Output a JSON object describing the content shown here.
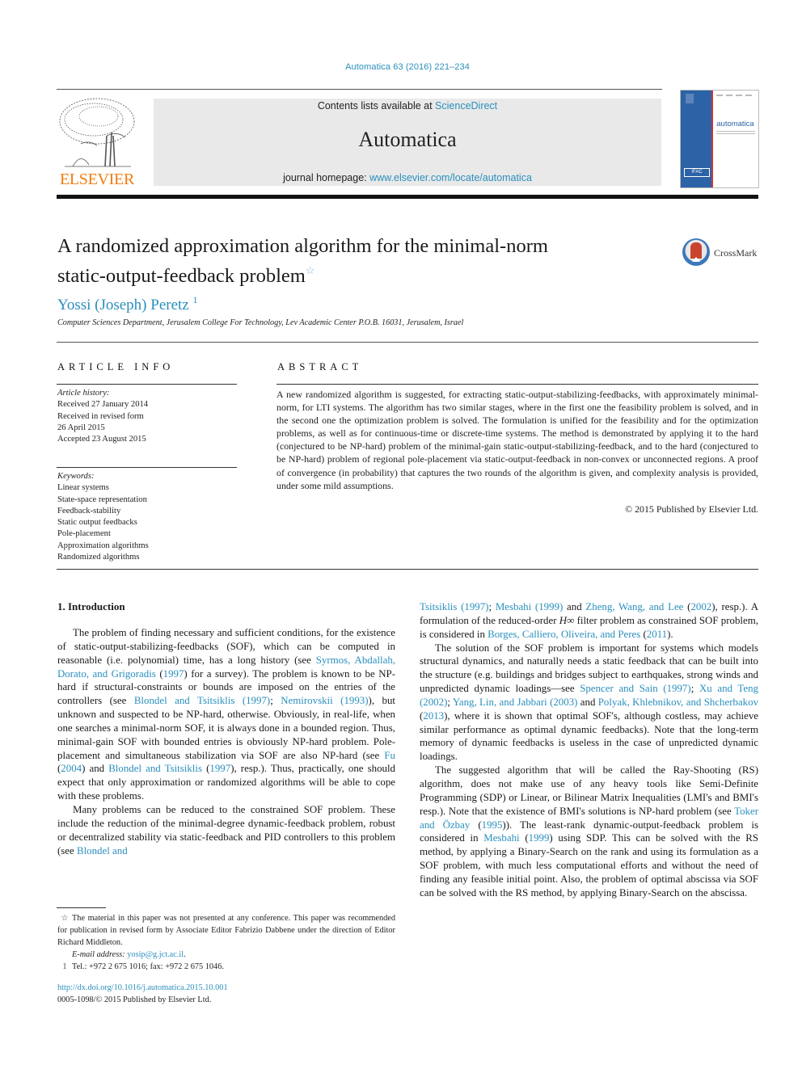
{
  "header": {
    "journal_ref": "Automatica 63 (2016) 221–234",
    "contents_prefix": "Contents lists available at ",
    "contents_link": "ScienceDirect",
    "journal_name": "Automatica",
    "homepage_prefix": "journal homepage: ",
    "homepage_link": "www.elsevier.com/locate/automatica",
    "publisher_logo_text": "ELSEVIER",
    "cover_title": "automatica",
    "cover_badge": "IFAC",
    "crossmark_label": "CrossMark",
    "colors": {
      "link": "#2a8fbd",
      "elsevier_orange": "#f07d10",
      "banner_gray": "#e9e9e9",
      "cover_blue": "#2b63a6"
    }
  },
  "article": {
    "title_line1": "A randomized approximation algorithm for the minimal-norm",
    "title_line2": "static-output-feedback problem",
    "title_mark": "☆",
    "author": "Yossi (Joseph) Peretz",
    "author_mark": "1",
    "affiliation": "Computer Sciences Department, Jerusalem College For Technology, Lev Academic Center P.O.B. 16031, Jerusalem, Israel"
  },
  "article_info": {
    "heading": "ARTICLE INFO",
    "history_label": "Article history:",
    "history": [
      "Received 27 January 2014",
      "Received in revised form",
      "26 April 2015",
      "Accepted 23 August 2015"
    ],
    "keywords_label": "Keywords:",
    "keywords": [
      "Linear systems",
      "State-space representation",
      "Feedback-stability",
      "Static output feedbacks",
      "Pole-placement",
      "Approximation algorithms",
      "Randomized algorithms"
    ]
  },
  "abstract": {
    "heading": "ABSTRACT",
    "text": "A new randomized algorithm is suggested, for extracting static-output-stabilizing-feedbacks, with approximately minimal-norm, for LTI systems. The algorithm has two similar stages, where in the first one the feasibility problem is solved, and in the second one the optimization problem is solved. The formulation is unified for the feasibility and for the optimization problems, as well as for continuous-time or discrete-time systems. The method is demonstrated by applying it to the hard (conjectured to be NP-hard) problem of the minimal-gain static-output-stabilizing-feedback, and to the hard (conjectured to be NP-hard) problem of regional pole-placement via static-output-feedback in non-convex or unconnected regions. A proof of convergence (in probability) that captures the two rounds of the algorithm is given, and complexity analysis is provided, under some mild assumptions.",
    "copyright": "© 2015 Published by Elsevier Ltd."
  },
  "body": {
    "intro_heading": "1.  Introduction",
    "p1": [
      {
        "t": "The problem of finding necessary and sufficient conditions, for the existence of static-output-stabilizing-feedbacks (SOF), which can be computed in reasonable (i.e. polynomial) time, has a long history (see "
      },
      {
        "l": "Syrmos, Abdallah, Dorato, and Grigoradis"
      },
      {
        "t": " ("
      },
      {
        "l": "1997"
      },
      {
        "t": ") for a survey). The problem is known to be NP-hard if structural-constraints or bounds are imposed on the entries of the controllers (see "
      },
      {
        "l": "Blondel and Tsitsiklis (1997)"
      },
      {
        "t": "; "
      },
      {
        "l": "Nemirovskii (1993)"
      },
      {
        "t": "), but unknown and suspected to be NP-hard, otherwise. Obviously, in real-life, when one searches a minimal-norm SOF, it is always done in a bounded region. Thus, minimal-gain SOF with bounded entries is obviously NP-hard problem. Pole-placement and simultaneous stabilization via SOF are also NP-hard (see "
      },
      {
        "l": "Fu"
      },
      {
        "t": " ("
      },
      {
        "l": "2004"
      },
      {
        "t": ") and "
      },
      {
        "l": "Blondel and Tsitsiklis"
      },
      {
        "t": " ("
      },
      {
        "l": "1997"
      },
      {
        "t": "), resp.). Thus, practically, one should expect that only approximation or randomized algorithms will be able to cope with these problems."
      }
    ],
    "p2": [
      {
        "t": "Many problems can be reduced to the constrained SOF problem. These include the reduction of the minimal-degree dynamic-feedback problem, robust or decentralized stability via static-feedback and PID controllers to this problem (see "
      },
      {
        "l": "Blondel and"
      }
    ],
    "p2_cont": [
      {
        "l": "Tsitsiklis (1997)"
      },
      {
        "t": "; "
      },
      {
        "l": "Mesbahi (1999)"
      },
      {
        "t": " and "
      },
      {
        "l": "Zheng, Wang, and Lee"
      },
      {
        "t": " ("
      },
      {
        "l": "2002"
      },
      {
        "t": "), resp.). A formulation of the reduced-order "
      },
      {
        "m": "H∞"
      },
      {
        "t": " filter problem as constrained SOF problem, is considered in "
      },
      {
        "l": "Borges, Calliero, Oliveira, and Peres"
      },
      {
        "t": " ("
      },
      {
        "l": "2011"
      },
      {
        "t": ")."
      }
    ],
    "p3": [
      {
        "t": "The solution of the SOF problem is important for systems which models structural dynamics, and naturally needs a static feedback that can be built into the structure (e.g. buildings and bridges subject to earthquakes, strong winds and unpredicted dynamic loadings—see "
      },
      {
        "l": "Spencer and Sain (1997)"
      },
      {
        "t": "; "
      },
      {
        "l": "Xu and Teng (2002)"
      },
      {
        "t": "; "
      },
      {
        "l": "Yang, Lin, and Jabbari (2003)"
      },
      {
        "t": " and "
      },
      {
        "l": "Polyak, Khlebnikov, and Shcherbakov"
      },
      {
        "t": " ("
      },
      {
        "l": "2013"
      },
      {
        "t": "), where it is shown that optimal SOF's, although costless, may achieve similar performance as optimal dynamic feedbacks). Note that the long-term memory of dynamic feedbacks is useless in the case of unpredicted dynamic loadings."
      }
    ],
    "p4": [
      {
        "t": "The suggested algorithm that will be called the Ray-Shooting (RS) algorithm, does not make use of any heavy tools like Semi-Definite Programming (SDP) or Linear, or Bilinear Matrix Inequalities (LMI's and BMI's resp.). Note that the existence of BMI's solutions is NP-hard problem (see "
      },
      {
        "l": "Toker and Özbay"
      },
      {
        "t": " ("
      },
      {
        "l": "1995"
      },
      {
        "t": ")). The least-rank dynamic-output-feedback problem is considered in "
      },
      {
        "l": "Mesbahi"
      },
      {
        "t": " ("
      },
      {
        "l": "1999"
      },
      {
        "t": ") using SDP. This can be solved with the RS method, by applying a Binary-Search on the rank and using its formulation as a SOF problem, with much less computational efforts and without the need of finding any feasible initial point. Also, the problem of optimal abscissa via SOF can be solved with the RS method, by applying Binary-Search on the abscissa."
      }
    ]
  },
  "footnotes": {
    "star_mark": "☆",
    "star_text": "The material in this paper was not presented at any conference. This paper was recommended for publication in revised form by Associate Editor Fabrizio Dabbene under the direction of Editor Richard Middleton.",
    "email_label": "E-mail address:",
    "email": "yosip@g.jct.ac.il",
    "email_end": ".",
    "one_mark": "1",
    "one_text": "Tel.: +972 2 675 1016; fax: +972 2 675 1046.",
    "doi": "http://dx.doi.org/10.1016/j.automatica.2015.10.001",
    "issn": "0005-1098/© 2015 Published by Elsevier Ltd."
  }
}
